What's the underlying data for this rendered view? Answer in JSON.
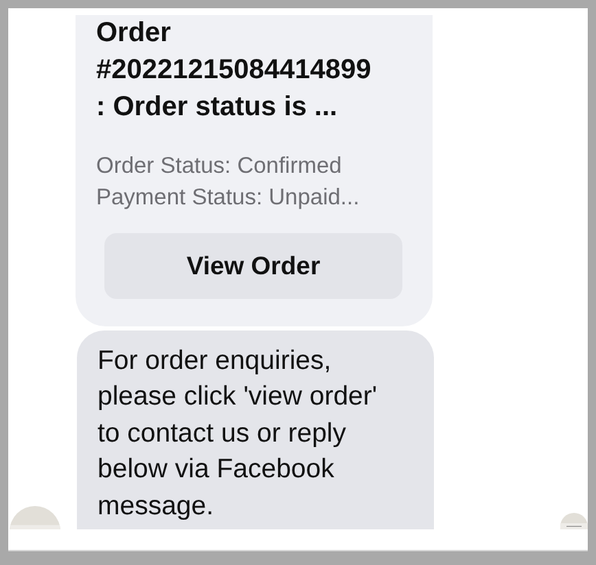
{
  "order_card": {
    "title": "Order\n#20221215084414899\n: Order status is ...",
    "details": [
      "Order Status: Confirmed",
      "Payment Status: Unpaid..."
    ],
    "button": "View Order"
  },
  "message": {
    "text": "For order enquiries,\nplease click 'view order'\nto contact us or reply\nbelow via Facebook\nmessage."
  }
}
